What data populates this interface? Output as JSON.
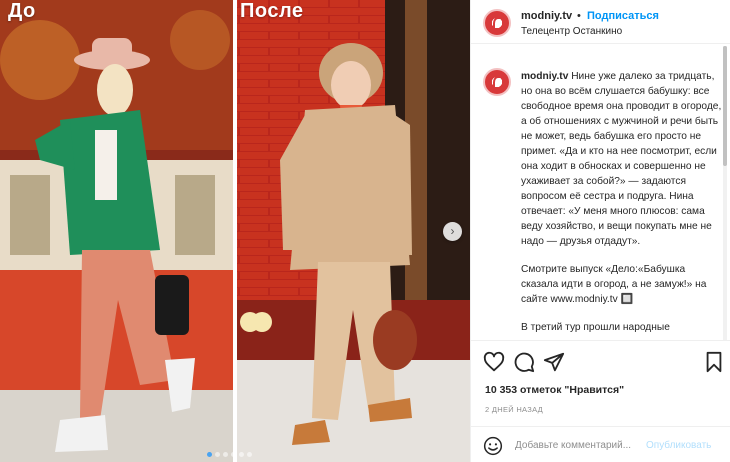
{
  "media": {
    "label_before": "До",
    "label_after": "После",
    "next_arrow": "›",
    "dots_count": 6
  },
  "header": {
    "username": "modniy.tv",
    "separator": "•",
    "follow": "Подписаться",
    "location": "Телецентр Останкино"
  },
  "caption": {
    "username": "modniy.tv",
    "text1": "Нине уже далеко за тридцать, но она во всём слушается бабушку: все свободное время она проводит в огороде, а об отношениях с мужчиной и речи быть не может, ведь бабушка его просто не примет. «Да и кто на нее посмотрит, если она ходит в обносках и совершенно не ухаживает за собой?» — задаются вопросом её сестра и подруга. Нина отвечает: «У меня много плюсов: сама веду хозяйство, и вещи покупать мне не надо — друзья отдадут».",
    "text2": "Смотрите выпуск «Дело:«Бабушка сказала идти в огород, а не замуж!» на сайте www.modniy.tv 🔲",
    "text3": "В третий тур прошли народные"
  },
  "stats": {
    "likes": "10 353 отметок \"Нравится\"",
    "date": "2 ДНЕЙ НАЗАД"
  },
  "comment": {
    "placeholder": "Добавьте комментарий...",
    "publish": "Опубликовать"
  },
  "icons": [
    "heart-icon",
    "comment-icon",
    "share-icon",
    "bookmark-icon",
    "smile-icon"
  ],
  "colors": {
    "accent": "#0095f6",
    "avatar_red": "#d8393a",
    "muted": "#8e8e8e"
  }
}
